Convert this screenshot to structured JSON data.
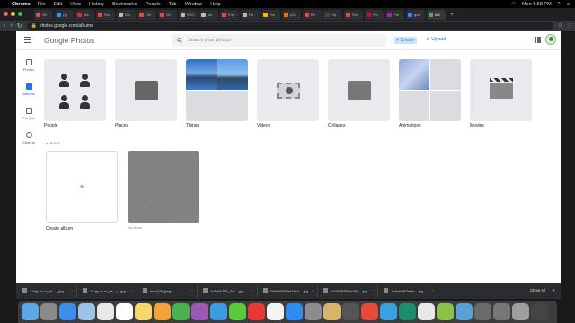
{
  "menubar": {
    "app": "Chrome",
    "items": [
      "File",
      "Edit",
      "View",
      "History",
      "Bookmarks",
      "People",
      "Tab",
      "Window",
      "Help"
    ],
    "clock": "Mon 6:58 PM"
  },
  "tabs": [
    {
      "label": "Sh",
      "color": "#e64a3c"
    },
    {
      "label": "(2)",
      "color": "#2d8cff"
    },
    {
      "label": "Ma",
      "color": "#d93025"
    },
    {
      "label": "Sm",
      "color": "#e64a3c"
    },
    {
      "label": "Sm",
      "color": "#bbbbbb"
    },
    {
      "label": "Chr",
      "color": "#e64a3c"
    },
    {
      "label": "Sh",
      "color": "#e64a3c"
    },
    {
      "label": "SEO",
      "color": "#bbbbbb"
    },
    {
      "label": "pin",
      "color": "#bbbbbb"
    },
    {
      "label": "Fre",
      "color": "#e64a3c"
    },
    {
      "label": "Ho",
      "color": "#bbbbbb"
    },
    {
      "label": "Fre",
      "color": "#ffb300"
    },
    {
      "label": "(Co",
      "color": "#ff6d00"
    },
    {
      "label": "Re",
      "color": "#e64a3c"
    },
    {
      "label": "Ho",
      "color": "#444444"
    },
    {
      "label": "Sm",
      "color": "#e64a3c"
    },
    {
      "label": "Pin",
      "color": "#e60023"
    },
    {
      "label": "Fre",
      "color": "#9c27b0"
    },
    {
      "label": "goo",
      "color": "#4285f4"
    },
    {
      "label": "Alb",
      "color": "#4caf50",
      "active": true
    }
  ],
  "address": {
    "url": "photos.google.com/albums"
  },
  "header": {
    "logo_google": "Google",
    "logo_photos": "Photos",
    "search_placeholder": "Search your photos",
    "create_label": "Create",
    "upload_label": "Upload"
  },
  "sidebar": [
    {
      "label": "Photos",
      "active": false
    },
    {
      "label": "Albums",
      "active": true
    },
    {
      "label": "For you",
      "active": false
    },
    {
      "label": "Sharing",
      "active": false
    }
  ],
  "categories": [
    {
      "label": "People"
    },
    {
      "label": "Places"
    },
    {
      "label": "Things"
    },
    {
      "label": "Videos"
    },
    {
      "label": "Collages"
    },
    {
      "label": "Animations"
    },
    {
      "label": "Movies"
    }
  ],
  "albums_heading": "ALBUMS",
  "albums": [
    {
      "label": "Create album",
      "sub": ""
    },
    {
      "label": "",
      "sub": "No items"
    }
  ],
  "downloads": [
    "47ujy-zc-vi_as..._.jpg",
    "47ujy-zc-vi_as..._1.jpg",
    "mel (16).jpeg",
    "1c682b761_7cf....jpg",
    "f3e5e09575a7d14....jpg",
    "800375f7f13e05d....jpg",
    "1e9cb1862e5e....jpg"
  ],
  "downloads_show_all": "Show All",
  "dock_colors": [
    "#5aa9e6",
    "#8a8a8a",
    "#3d8ee8",
    "#9fc3e8",
    "#e8e8e8",
    "#ffffff",
    "#f5d76e",
    "#f2a33a",
    "#4caf50",
    "#9b59b6",
    "#3b9ae1",
    "#5ac93c",
    "#e53935",
    "#f4f4f4",
    "#2f8cf0",
    "#8c8c8c",
    "#d9b26b",
    "#555555",
    "#e64a3c",
    "#3aa0e0",
    "#1e8c6e",
    "#e8e8e8",
    "#8bc34a",
    "#5aa0d0",
    "#6a6a6a",
    "#777777",
    "#9e9e9e",
    "#444444"
  ]
}
